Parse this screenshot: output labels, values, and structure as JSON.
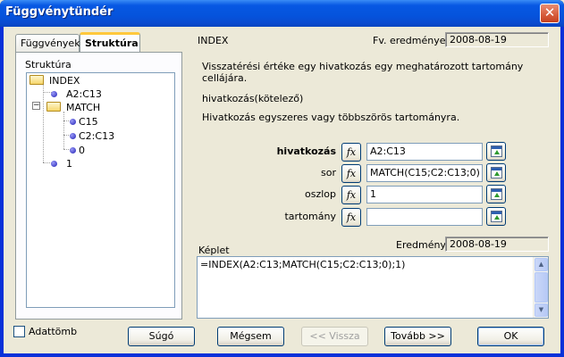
{
  "window": {
    "title": "Függvénytündér",
    "close_glyph": "✕"
  },
  "tabs": [
    {
      "label": "Függvények"
    },
    {
      "label": "Struktúra"
    }
  ],
  "structure": {
    "label": "Struktúra",
    "tree": [
      {
        "label": "INDEX",
        "icon": "folder-icon"
      },
      {
        "label": "A2:C13",
        "icon": "dot-icon"
      },
      {
        "label": "MATCH",
        "icon": "folder-icon",
        "expander": "−"
      },
      {
        "label": "C15",
        "icon": "dot-icon"
      },
      {
        "label": "C2:C13",
        "icon": "dot-icon"
      },
      {
        "label": "0",
        "icon": "dot-icon"
      },
      {
        "label": "1",
        "icon": "dot-icon"
      }
    ]
  },
  "function": {
    "name": "INDEX",
    "result_label": "Fv. eredménye:",
    "result_value": "2008-08-19",
    "description": "Visszatérési értéke egy hivatkozás egy meghatározott tartomány cellájára.",
    "param_title": "hivatkozás(kötelező)",
    "param_description": "Hivatkozás egyszeres vagy többszörös tartományra."
  },
  "arguments": [
    {
      "label": "hivatkozás",
      "value": "A2:C13",
      "fx": "fx"
    },
    {
      "label": "sor",
      "value": "MATCH(C15;C2:C13;0)",
      "fx": "fx"
    },
    {
      "label": "oszlop",
      "value": "1",
      "fx": "fx"
    },
    {
      "label": "tartomány",
      "value": "",
      "fx": "fx"
    }
  ],
  "formula": {
    "label": "Képlet",
    "result_label": "Eredmény",
    "result_value": "2008-08-19",
    "text": "=INDEX(A2:C13;MATCH(C15;C2:C13;0);1)"
  },
  "footer": {
    "array_checkbox": "Adattömb",
    "help": "Súgó",
    "cancel": "Mégsem",
    "back": "<< Vissza",
    "next": "Tovább >>",
    "ok": "OK"
  }
}
